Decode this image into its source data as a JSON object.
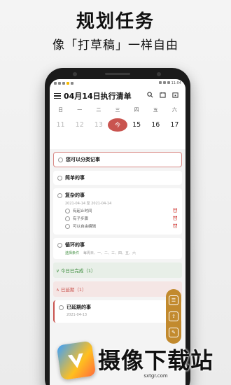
{
  "promo": {
    "headline": "规划任务",
    "subheadline": "像「打草稿」一样自由"
  },
  "status_bar": {
    "time": "11:04"
  },
  "header": {
    "title": "04月14日执行清单"
  },
  "calendar": {
    "weekdays": [
      "日",
      "一",
      "二",
      "三",
      "四",
      "五",
      "六"
    ],
    "dates": [
      "11",
      "12",
      "13",
      "今",
      "15",
      "16",
      "17"
    ]
  },
  "tasks": {
    "focus_task": "您可以分类记事",
    "simple_task": "简单的事",
    "complex_task": {
      "title": "复杂的事",
      "date_range": "2021-04-14 至 2021-04-14",
      "subtasks": [
        "有起止时间",
        "有子步骤",
        "可以自由编辑"
      ]
    },
    "repeat_task": {
      "title": "循环的事",
      "repeat_label": "选择条件",
      "repeat_days": "每周日、一、二、三、四、五、六"
    }
  },
  "sections": {
    "done": "∨ 今日已完成（1）",
    "overdue": "∧ 已延期（1）"
  },
  "overdue_task": {
    "title": "已延期的事",
    "date": "2021-04-13"
  },
  "watermark": {
    "brand": "摄像下载站",
    "url": "sxtgr.com"
  }
}
